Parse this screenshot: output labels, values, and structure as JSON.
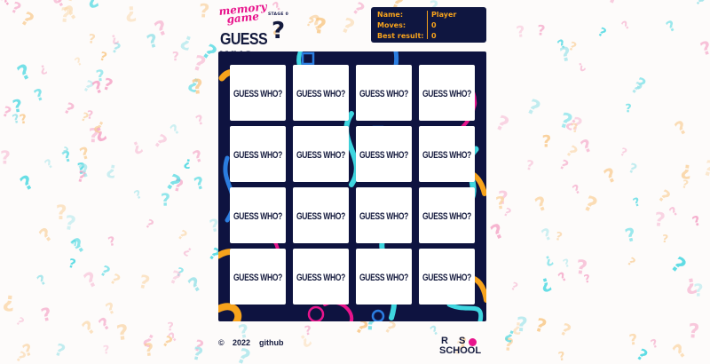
{
  "header": {
    "logo_script": [
      "memory",
      "game"
    ],
    "logo_stage": "STAGE 0",
    "logo_title": "GUESS WHO"
  },
  "stats": {
    "rows": [
      {
        "label": "Name:",
        "value": "Player"
      },
      {
        "label": "Moves:",
        "value": "0"
      },
      {
        "label": "Best result:",
        "value": "0"
      }
    ]
  },
  "board": {
    "cards": [
      "GUESS WHO?",
      "GUESS WHO?",
      "GUESS WHO?",
      "GUESS WHO?",
      "GUESS WHO?",
      "GUESS WHO?",
      "GUESS WHO?",
      "GUESS WHO?",
      "GUESS WHO?",
      "GUESS WHO?",
      "GUESS WHO?",
      "GUESS WHO?",
      "GUESS WHO?",
      "GUESS WHO?",
      "GUESS WHO?",
      "GUESS WHO?"
    ]
  },
  "footer": {
    "copyright": "©",
    "year": "2022",
    "link": "github",
    "school_logo_top": "RS",
    "school_logo_bottom": "SCHOOL"
  },
  "colors": {
    "pink": "#e8148c",
    "cyan": "#3fd6e0",
    "orange": "#f7a31c",
    "navy": "#0e1340"
  }
}
